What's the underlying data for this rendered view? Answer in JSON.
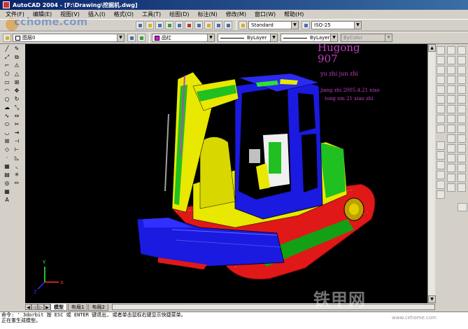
{
  "window": {
    "title": "AutoCAD 2004 - [F:\\Drawing\\挖掘机.dwg]"
  },
  "watermark": "cchome.com",
  "watermark_bottom": "铁甲网",
  "watermark_bottom_sub": "www.cehome.com",
  "menu": [
    "文件(F)",
    "编辑(E)",
    "视图(V)",
    "插入(I)",
    "格式(O)",
    "工具(T)",
    "绘图(D)",
    "标注(N)",
    "修改(M)",
    "窗口(W)",
    "帮助(H)"
  ],
  "toolbar1": {
    "text_style": "Standard",
    "dim_style": "ISO-25"
  },
  "toolbar2": {
    "layer": "图层0",
    "color": "品红",
    "color_hex": "#ff00ff",
    "linetype": "ByLayer",
    "lineweight": "ByLayer",
    "plotstyle": "ByColor"
  },
  "drawing": {
    "background": "#000000",
    "annotations": [
      "Hugong",
      "907",
      "yu zhi jun zhi",
      "jiang zhi 2005.4.21 xiao",
      "tong xin 21 xiao zhi"
    ]
  },
  "tabs": [
    "模型",
    "布局1",
    "布局2"
  ],
  "command_lines": [
    "命令: '_3dorbit 按 ESC 或 ENTER 键退出, 或者单击鼠标右键显示快捷菜单。",
    "正在重生成模型。"
  ]
}
